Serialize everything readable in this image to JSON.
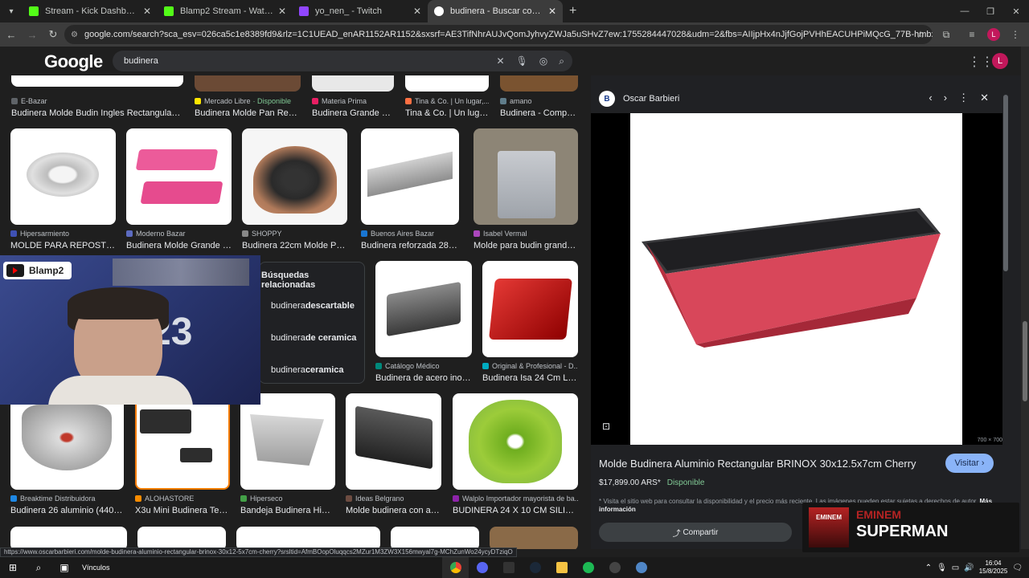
{
  "tabs": [
    {
      "title": "Stream - Kick Dashboard",
      "color": "#53fc18"
    },
    {
      "title": "Blamp2 Stream - Watch Live on",
      "color": "#53fc18"
    },
    {
      "title": "yo_nen_ - Twitch",
      "color": "#9146ff"
    },
    {
      "title": "budinera - Buscar con Google",
      "color": "#4285f4",
      "active": true
    }
  ],
  "url": "google.com/search?sca_esv=026ca5c1e8389fd9&rlz=1C1UEAD_enAR1152AR1152&sxsrf=AE3TifNhrAUJvQomJyhvyZWJa5uSHvZ7ew:1755284447028&udm=2&fbs=AIIjpHx4nJjfGojPVHhEACUHPiMQcG_77B-hmbxHSx0Fwu3oUGVAxkUj6FedW1OxjK...",
  "google": {
    "logo": "Google",
    "query": "budinera"
  },
  "row0": [
    {
      "src": "E-Bazar",
      "title": "Budinera Molde Budin Ingles Rectangular Anti..."
    },
    {
      "src": "Mercado Libre",
      "avail": "· Disponible",
      "title": "Budinera Molde Pan Repos..."
    },
    {
      "src": "Materia Prima",
      "title": "Budinera Grande 30..."
    },
    {
      "src": "Tina & Co. | Un lugar,...",
      "title": "Tina & Co. | Un lugar..."
    },
    {
      "src": "amano",
      "title": "Budinera - Compra..."
    }
  ],
  "row1": [
    {
      "src": "Hipersarmiento",
      "title": "MOLDE PARA REPOSTE..."
    },
    {
      "src": "Moderno Bazar",
      "title": "Budinera Molde Grande P..."
    },
    {
      "src": "SHOPPY",
      "title": "Budinera 22cm Molde Pan ..."
    },
    {
      "src": "Buenos Aires Bazar",
      "title": "Budinera reforzada 28cm -..."
    },
    {
      "src": "Isabel Vermal",
      "title": "Molde para budin grande/ ..."
    }
  ],
  "related": {
    "title": "Búsquedas relacionadas",
    "items": [
      {
        "pre": "budinera ",
        "bold": "descartable"
      },
      {
        "pre": "budinera ",
        "bold": "de ceramica"
      },
      {
        "pre": "budinera ",
        "bold": "ceramica"
      }
    ]
  },
  "row2": [
    {
      "src": "Catálogo Médico",
      "title": "Budinera de acero inoxi..."
    },
    {
      "src": "Original & Profesional - D...",
      "title": "Budinera Isa 24 Cm Lad..."
    }
  ],
  "row3": [
    {
      "src": "Breaktime Distribuidora",
      "title": "Budinera 26 aluminio (44013..."
    },
    {
      "src": "ALOHASTORE",
      "title": "X3u Mini Budinera Teflo..."
    },
    {
      "src": "Hiperseco",
      "title": "Bandeja Budinera Hiper..."
    },
    {
      "src": "Ideas Belgrano",
      "title": "Molde budinera con anti..."
    },
    {
      "src": "Walplo Importador mayorista de ba...",
      "title": "BUDINERA 24 X 10 CM SILICO..."
    }
  ],
  "stream": {
    "name": "Blamp2",
    "balloon": "23"
  },
  "preview": {
    "site": "Oscar Barbieri",
    "site_initial": "B",
    "size": "700 × 700",
    "title": "Molde Budinera Aluminio Rectangular BRINOX 30x12.5x7cm Cherry",
    "visit": "Visitar",
    "price": "$17,899.00 ARS*",
    "avail": "Disponible",
    "note": "* Visita el sitio web para consultar la disponibilidad y el precio más reciente. Las imágenes pueden estar sujetas a derechos de autor.",
    "note_link": "Más información",
    "share": "Compartir"
  },
  "music": {
    "artist": "EMINEM",
    "song": "SUPERMAN",
    "cover": "EMINEM"
  },
  "status_url": "https://www.oscarbarbieri.com/molde-budinera-aluminio-rectangular-brinox-30x12-5x7cm-cherry?srsltid=AfmBOopOluqqcs2MZur1M3ZW3X156mwyal7g-MChZunWo24ycyDTziqO",
  "taskbar": {
    "search_label": "Vínculos",
    "time": "16:04",
    "date": "15/8/2025"
  }
}
